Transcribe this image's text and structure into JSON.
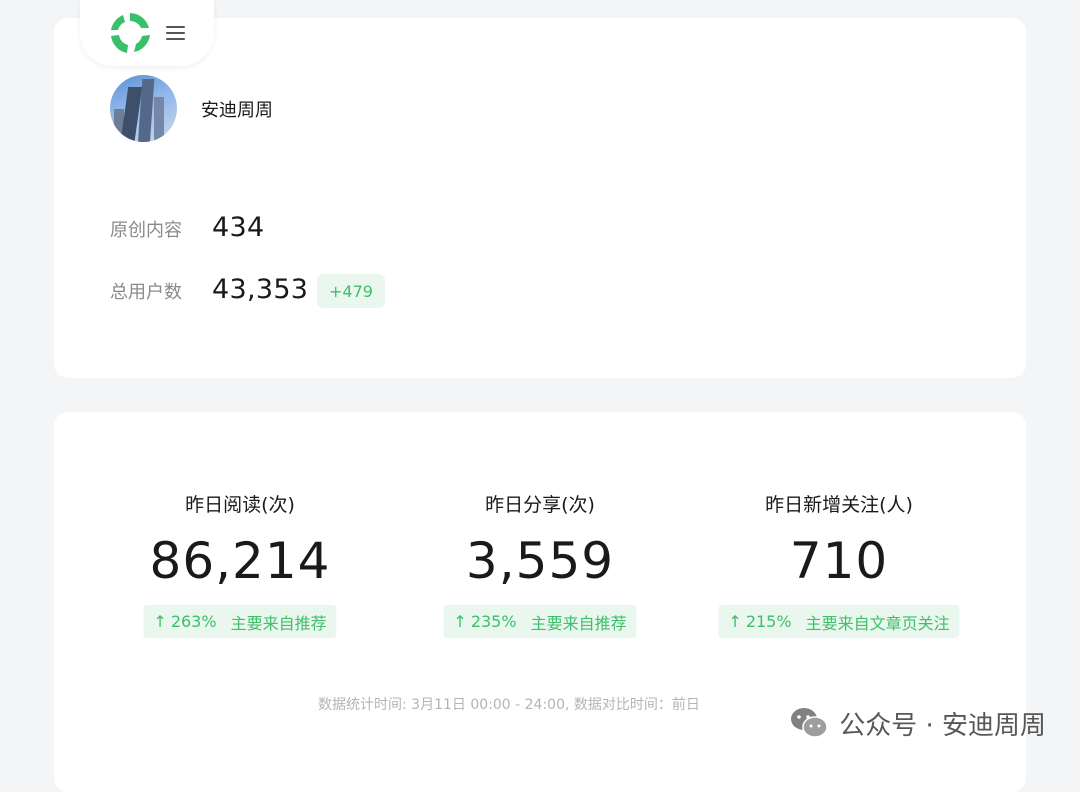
{
  "header": {
    "logo_icon": "wechat-mp-logo-icon",
    "menu_icon": "menu-icon"
  },
  "profile": {
    "name": "安迪周周",
    "stats": [
      {
        "label": "原创内容",
        "value": "434"
      },
      {
        "label": "总用户数",
        "value": "43,353",
        "delta": "+479"
      }
    ]
  },
  "metrics": [
    {
      "title": "昨日阅读(次)",
      "value": "86,214",
      "arrow": "↑",
      "percent": "263%",
      "source": "主要来自推荐"
    },
    {
      "title": "昨日分享(次)",
      "value": "3,559",
      "arrow": "↑",
      "percent": "235%",
      "source": "主要来自推荐"
    },
    {
      "title": "昨日新增关注(人)",
      "value": "710",
      "arrow": "↑",
      "percent": "215%",
      "source": "主要来自文章页关注"
    }
  ],
  "footnote": "数据统计时间: 3月11日 00:00 - 24:00, 数据对比时间：前日",
  "watermark": {
    "text": "公众号 · 安迪周周",
    "icon": "wechat-icon"
  },
  "colors": {
    "accent_green": "#3fbf6a",
    "badge_bg": "#e9f7ee",
    "page_bg": "#f4f5f7"
  }
}
